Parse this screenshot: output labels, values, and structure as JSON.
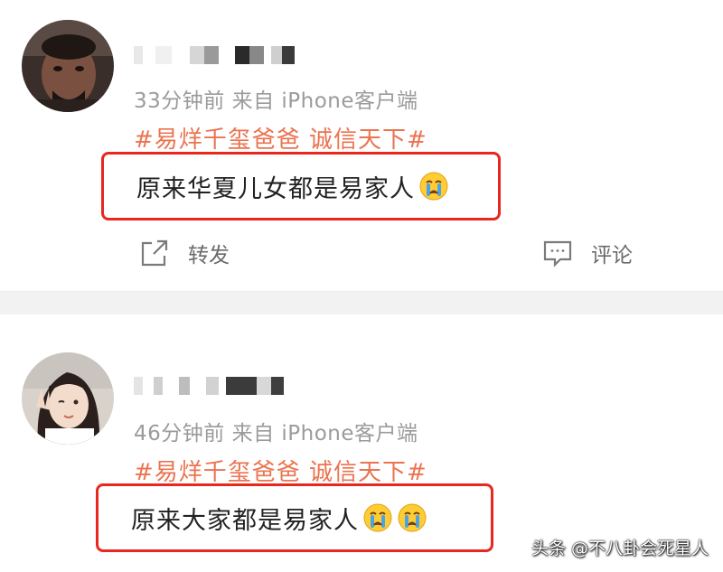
{
  "posts": [
    {
      "meta": "33分钟前  来自 iPhone客户端",
      "topic": "#易烊千玺爸爸 诚信天下#",
      "content": "原来华夏儿女都是易家人",
      "emoji_icons": [
        "crying-emoji-icon"
      ],
      "actions": {
        "repost_label": "转发",
        "comment_label": "评论"
      }
    },
    {
      "meta": "46分钟前  来自 iPhone客户端",
      "topic": "#易烊千玺爸爸 诚信天下#",
      "content": "原来大家都是易家人",
      "emoji_icons": [
        "crying-emoji-icon",
        "crying-emoji-icon"
      ]
    }
  ],
  "watermark": "头条 @不八卦会死星人",
  "colors": {
    "topic": "#eb7350",
    "highlight_border": "#e8281f",
    "meta": "#9b9b9b",
    "content": "#222222",
    "divider": "#f2f2f2"
  }
}
